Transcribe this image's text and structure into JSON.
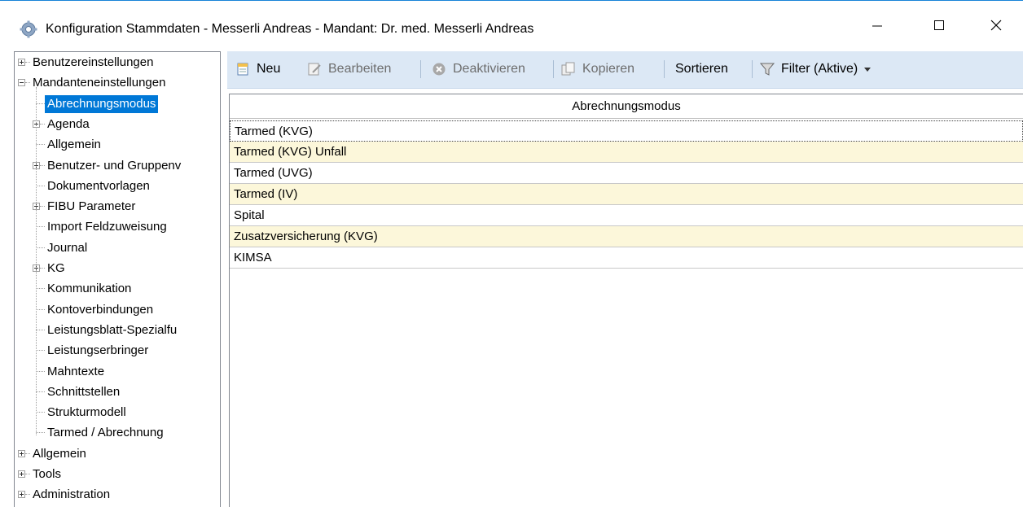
{
  "window": {
    "title": "Konfiguration Stammdaten - Messerli Andreas - Mandant: Dr. med. Messerli Andreas",
    "icon": "gear-icon",
    "controls": {
      "minimize": "minimize-icon",
      "maximize": "maximize-icon",
      "close": "close-icon"
    }
  },
  "tree": {
    "items": [
      {
        "label": "Benutzereinstellungen",
        "level": 0,
        "expander": "plus"
      },
      {
        "label": "Mandanteneinstellungen",
        "level": 0,
        "expander": "minus"
      },
      {
        "label": "Abrechnungsmodus",
        "level": 1,
        "expander": "none",
        "selected": true
      },
      {
        "label": "Agenda",
        "level": 1,
        "expander": "plus"
      },
      {
        "label": "Allgemein",
        "level": 1,
        "expander": "none"
      },
      {
        "label": "Benutzer- und Gruppenv",
        "level": 1,
        "expander": "plus"
      },
      {
        "label": "Dokumentvorlagen",
        "level": 1,
        "expander": "none"
      },
      {
        "label": "FIBU Parameter",
        "level": 1,
        "expander": "plus"
      },
      {
        "label": "Import Feldzuweisung",
        "level": 1,
        "expander": "none"
      },
      {
        "label": "Journal",
        "level": 1,
        "expander": "none"
      },
      {
        "label": "KG",
        "level": 1,
        "expander": "plus"
      },
      {
        "label": "Kommunikation",
        "level": 1,
        "expander": "none"
      },
      {
        "label": "Kontoverbindungen",
        "level": 1,
        "expander": "none"
      },
      {
        "label": "Leistungsblatt-Spezialfu",
        "level": 1,
        "expander": "none"
      },
      {
        "label": "Leistungserbringer",
        "level": 1,
        "expander": "none"
      },
      {
        "label": "Mahntexte",
        "level": 1,
        "expander": "none"
      },
      {
        "label": "Schnittstellen",
        "level": 1,
        "expander": "none"
      },
      {
        "label": "Strukturmodell",
        "level": 1,
        "expander": "none"
      },
      {
        "label": "Tarmed / Abrechnung",
        "level": 1,
        "expander": "none"
      },
      {
        "label": "Allgemein",
        "level": 0,
        "expander": "plus"
      },
      {
        "label": "Tools",
        "level": 0,
        "expander": "plus"
      },
      {
        "label": "Administration",
        "level": 0,
        "expander": "plus"
      }
    ]
  },
  "toolbar": {
    "new_label": "Neu",
    "edit_label": "Bearbeiten",
    "deactivate_label": "Deaktivieren",
    "copy_label": "Kopieren",
    "sort_label": "Sortieren",
    "filter_label": "Filter (Aktive)",
    "colors": {
      "background": "#dce8f5"
    }
  },
  "grid": {
    "header": "Abrechnungsmodus",
    "rows": [
      "Tarmed (KVG)",
      "Tarmed (KVG) Unfall",
      "Tarmed (UVG)",
      "Tarmed (IV)",
      "Spital",
      "Zusatzversicherung (KVG)",
      "KIMSA"
    ],
    "colors": {
      "selection": "#0078d7",
      "alt_row": "#fcf7da"
    }
  }
}
